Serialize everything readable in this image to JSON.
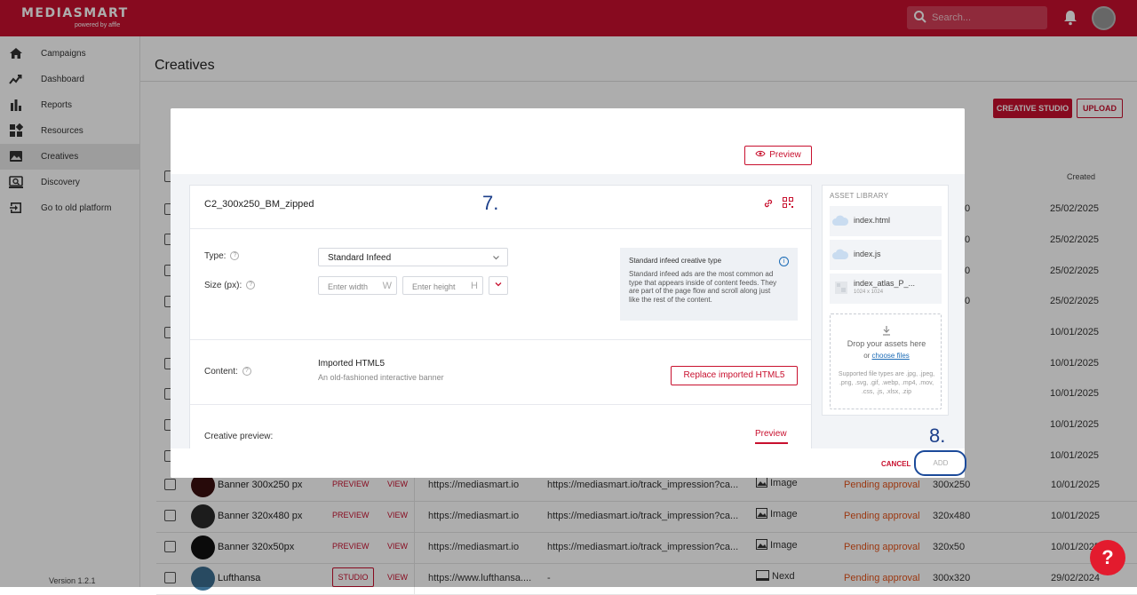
{
  "app": {
    "logo_text": "MEDIASMART",
    "logo_sub": "powered by affle",
    "search_placeholder": "Search...",
    "version": "Version 1.2.1"
  },
  "sidebar": {
    "items": [
      {
        "label": "Campaigns",
        "icon": "home-icon"
      },
      {
        "label": "Dashboard",
        "icon": "trend-icon"
      },
      {
        "label": "Reports",
        "icon": "bar-chart-icon"
      },
      {
        "label": "Resources",
        "icon": "resources-icon"
      },
      {
        "label": "Creatives",
        "icon": "image-icon",
        "active": true
      },
      {
        "label": "Discovery",
        "icon": "discovery-icon"
      },
      {
        "label": "Go to old platform",
        "icon": "exit-icon"
      }
    ]
  },
  "page": {
    "title": "Creatives",
    "btn_creative_studio": "CREATIVE STUDIO",
    "btn_upload": "UPLOAD",
    "col_created": "Created"
  },
  "bg_rows": {
    "partial": [
      {
        "suffix": "0",
        "date": "25/02/2025"
      },
      {
        "suffix": "0",
        "date": "25/02/2025"
      },
      {
        "suffix": "0",
        "date": "25/02/2025"
      },
      {
        "suffix": "0",
        "date": "25/02/2025"
      },
      {
        "suffix": "",
        "date": "10/01/2025"
      },
      {
        "suffix": "",
        "date": "10/01/2025"
      },
      {
        "suffix": "",
        "date": "10/01/2025"
      },
      {
        "suffix": "",
        "date": "10/01/2025"
      },
      {
        "suffix": "",
        "date": "10/01/2025"
      }
    ],
    "full": [
      {
        "name": "Banner 300x250 px",
        "action": "PREVIEW",
        "view": "VIEW",
        "url": "https://mediasmart.io",
        "track": "https://mediasmart.io/track_impression?ca...",
        "type": "Image",
        "status": "Pending approval",
        "size": "300x250",
        "date": "10/01/2025"
      },
      {
        "name": "Banner 320x480 px",
        "action": "PREVIEW",
        "view": "VIEW",
        "url": "https://mediasmart.io",
        "track": "https://mediasmart.io/track_impression?ca...",
        "type": "Image",
        "status": "Pending approval",
        "size": "320x480",
        "date": "10/01/2025"
      },
      {
        "name": "Banner 320x50px",
        "action": "PREVIEW",
        "view": "VIEW",
        "url": "https://mediasmart.io",
        "track": "https://mediasmart.io/track_impression?ca...",
        "type": "Image",
        "status": "Pending approval",
        "size": "320x50",
        "date": "10/01/2025"
      },
      {
        "name": "Lufthansa",
        "action": "STUDIO",
        "view": "VIEW",
        "url": "https://www.lufthansa....",
        "track": "-",
        "type": "Nexd",
        "status": "Pending approval",
        "size": "300x320",
        "date": "29/02/2024"
      }
    ]
  },
  "modal": {
    "preview_top": "Preview",
    "creative_name": "C2_300x250_BM_zipped",
    "type_label": "Type:",
    "type_value": "Standard Infeed",
    "size_label": "Size (px):",
    "width_placeholder": "Enter width",
    "width_suffix": "W",
    "height_placeholder": "Enter height",
    "height_suffix": "H",
    "info_title": "Standard infeed creative type",
    "info_desc": "Standard infeed ads are the most common ad type that appears inside of content feeds. They are part of the page flow and scroll along just like the rest of the content.",
    "content_label": "Content:",
    "content_value": "Imported HTML5",
    "content_sub": "An old-fashioned interactive banner",
    "replace_btn": "Replace imported HTML5",
    "creative_preview_label": "Creative preview:",
    "preview_tab": "Preview",
    "cancel": "CANCEL",
    "add": "ADD"
  },
  "asset_library": {
    "title": "ASSET LIBRARY",
    "items": [
      {
        "name": "index.html",
        "sub": ""
      },
      {
        "name": "index.js",
        "sub": ""
      },
      {
        "name": "index_atlas_P_...",
        "sub": "1024 x 1024"
      }
    ],
    "drop_text": "Drop your assets here",
    "drop_or": "or",
    "choose_files": "choose files",
    "supported": "Supported file types are .jpg, .jpeg, .png, .svg, .gif, .webp, .mp4, .mov, .css, .js, .xlsx, .zip"
  },
  "annotations": {
    "step7": "7.",
    "step8": "8."
  },
  "colors": {
    "brand": "#c8102e",
    "status": "#e5531a",
    "annotation": "#1b3e8a"
  }
}
